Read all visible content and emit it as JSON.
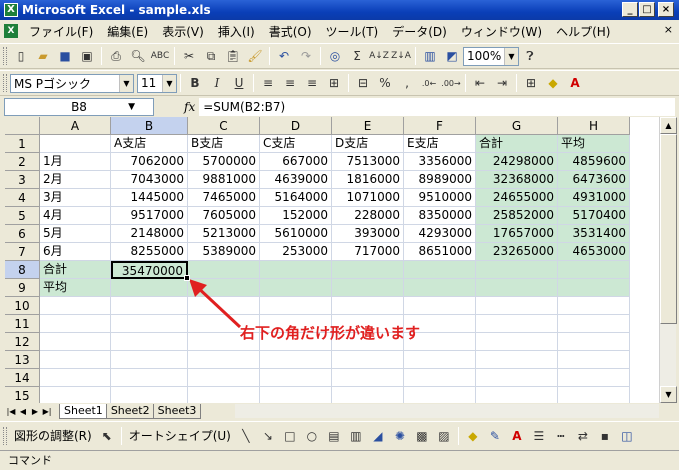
{
  "window": {
    "title": "Microsoft Excel - sample.xls"
  },
  "menu": [
    "ファイル(F)",
    "編集(E)",
    "表示(V)",
    "挿入(I)",
    "書式(O)",
    "ツール(T)",
    "データ(D)",
    "ウィンドウ(W)",
    "ヘルプ(H)"
  ],
  "standard_toolbar": {
    "zoom": "100%",
    "sigma": "Σ"
  },
  "format_toolbar": {
    "font": "MS Pゴシック",
    "size": "11",
    "bold": "B",
    "italic": "I",
    "underline": "U",
    "percent": "%"
  },
  "formula_bar": {
    "name_box": "B8",
    "fx": "fx",
    "formula": "=SUM(B2:B7)"
  },
  "columns": [
    "A",
    "B",
    "C",
    "D",
    "E",
    "F",
    "G",
    "H"
  ],
  "rows": [
    "1",
    "2",
    "3",
    "4",
    "5",
    "6",
    "7",
    "8",
    "9",
    "10",
    "11",
    "12",
    "13",
    "14",
    "15"
  ],
  "sheet": {
    "header": [
      "",
      "A支店",
      "B支店",
      "C支店",
      "D支店",
      "E支店",
      "合計",
      "平均"
    ],
    "data": [
      [
        "1月",
        "7062000",
        "5700000",
        "667000",
        "7513000",
        "3356000",
        "24298000",
        "4859600"
      ],
      [
        "2月",
        "7043000",
        "9881000",
        "4639000",
        "1816000",
        "8989000",
        "32368000",
        "6473600"
      ],
      [
        "3月",
        "1445000",
        "7465000",
        "5164000",
        "1071000",
        "9510000",
        "24655000",
        "4931000"
      ],
      [
        "4月",
        "9517000",
        "7605000",
        "152000",
        "228000",
        "8350000",
        "25852000",
        "5170400"
      ],
      [
        "5月",
        "2148000",
        "5213000",
        "5610000",
        "393000",
        "4293000",
        "17657000",
        "3531400"
      ],
      [
        "6月",
        "8255000",
        "5389000",
        "253000",
        "717000",
        "8651000",
        "23265000",
        "4653000"
      ]
    ],
    "total_label": "合計",
    "total_value": "35470000",
    "average_label": "平均"
  },
  "sheet_tabs": [
    "Sheet1",
    "Sheet2",
    "Sheet3"
  ],
  "draw_toolbar": {
    "adjust": "図形の調整(R)",
    "autoshape": "オートシェイプ(U)"
  },
  "annotation": "右下の角だけ形が違います",
  "status": "コマンド",
  "colors": {
    "title_bar": "#0A3FB8",
    "selection_fill": "#CCE8D3",
    "annotation": "#E02020"
  }
}
